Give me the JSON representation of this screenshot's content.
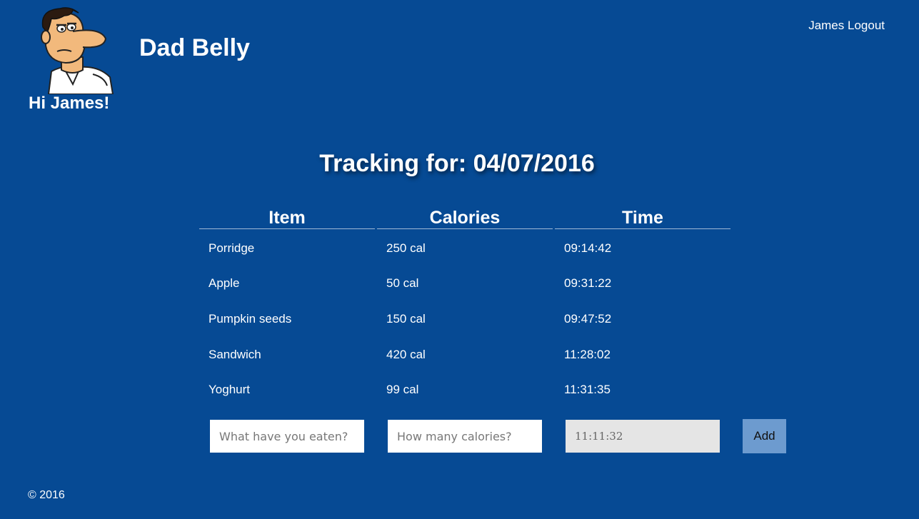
{
  "header": {
    "logo_icon": "cartoon-dad-icon",
    "app_title": "Dad Belly",
    "greeting": "Hi James!",
    "username": "James",
    "logout_label": "Logout"
  },
  "tracking": {
    "heading": "Tracking for: 04/07/2016"
  },
  "table": {
    "columns": [
      "Item",
      "Calories",
      "Time"
    ],
    "rows": [
      {
        "item": "Porridge",
        "calories": "250 cal",
        "time": "09:14:42"
      },
      {
        "item": "Apple",
        "calories": "50 cal",
        "time": "09:31:22"
      },
      {
        "item": "Pumpkin seeds",
        "calories": "150 cal",
        "time": "09:47:52"
      },
      {
        "item": "Sandwich",
        "calories": "420 cal",
        "time": "11:28:02"
      },
      {
        "item": "Yoghurt",
        "calories": "99 cal",
        "time": "11:31:35"
      }
    ]
  },
  "form": {
    "food_placeholder": "What have you eaten?",
    "calories_placeholder": "How many calories?",
    "time_value": "11:11:32",
    "add_label": "Add"
  },
  "footer": {
    "copyright": "© 2016"
  },
  "colors": {
    "background": "#064a94",
    "button": "#6d9bcf",
    "disabled_input": "#e5e5e5"
  }
}
